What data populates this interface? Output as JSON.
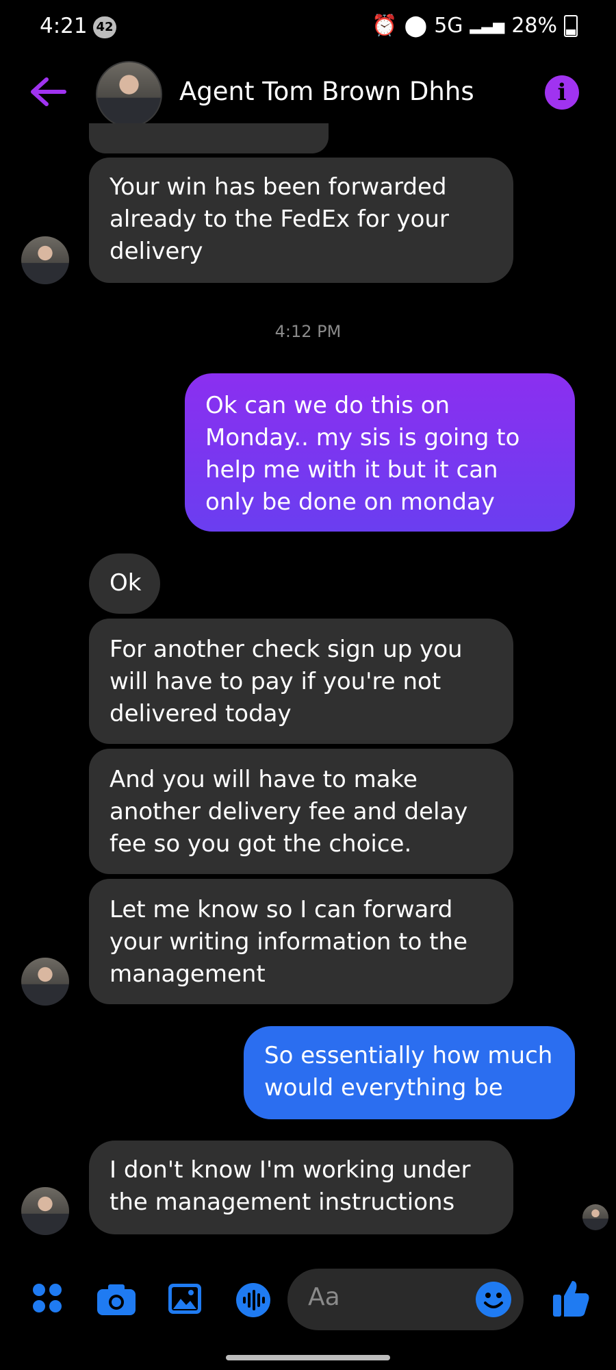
{
  "status_bar": {
    "time": "4:21",
    "notification_count": "42",
    "network": "5G",
    "battery": "28%"
  },
  "header": {
    "contact_name": "Agent Tom Brown Dhhs"
  },
  "messages": [
    {
      "from": "them",
      "text": "Your win has been forwarded already to the FedEx for your delivery"
    },
    {
      "from": "timestamp",
      "text": "4:12 PM"
    },
    {
      "from": "me",
      "text": "Ok can we do this on Monday.. my sis is going to help me with it but it can only be done on monday"
    },
    {
      "from": "them",
      "text": "Ok"
    },
    {
      "from": "them",
      "text": "For another check sign up you will have to pay if you're not delivered today"
    },
    {
      "from": "them",
      "text": "And you will have to make another delivery fee and delay fee so you got the choice."
    },
    {
      "from": "them",
      "text": "Let me know so I can forward your writing information to the management"
    },
    {
      "from": "me",
      "text": "So essentially how much would everything  be"
    },
    {
      "from": "them",
      "text": "I don't know I'm working under the management instructions"
    }
  ],
  "composer": {
    "placeholder": "Aa"
  },
  "colors": {
    "accent": "#a033f0",
    "bubble_in": "#303030",
    "bubble_out_purple": "#8b2ff0",
    "bubble_out_blue": "#2b6ef0",
    "icon_blue": "#1f7bf2"
  }
}
